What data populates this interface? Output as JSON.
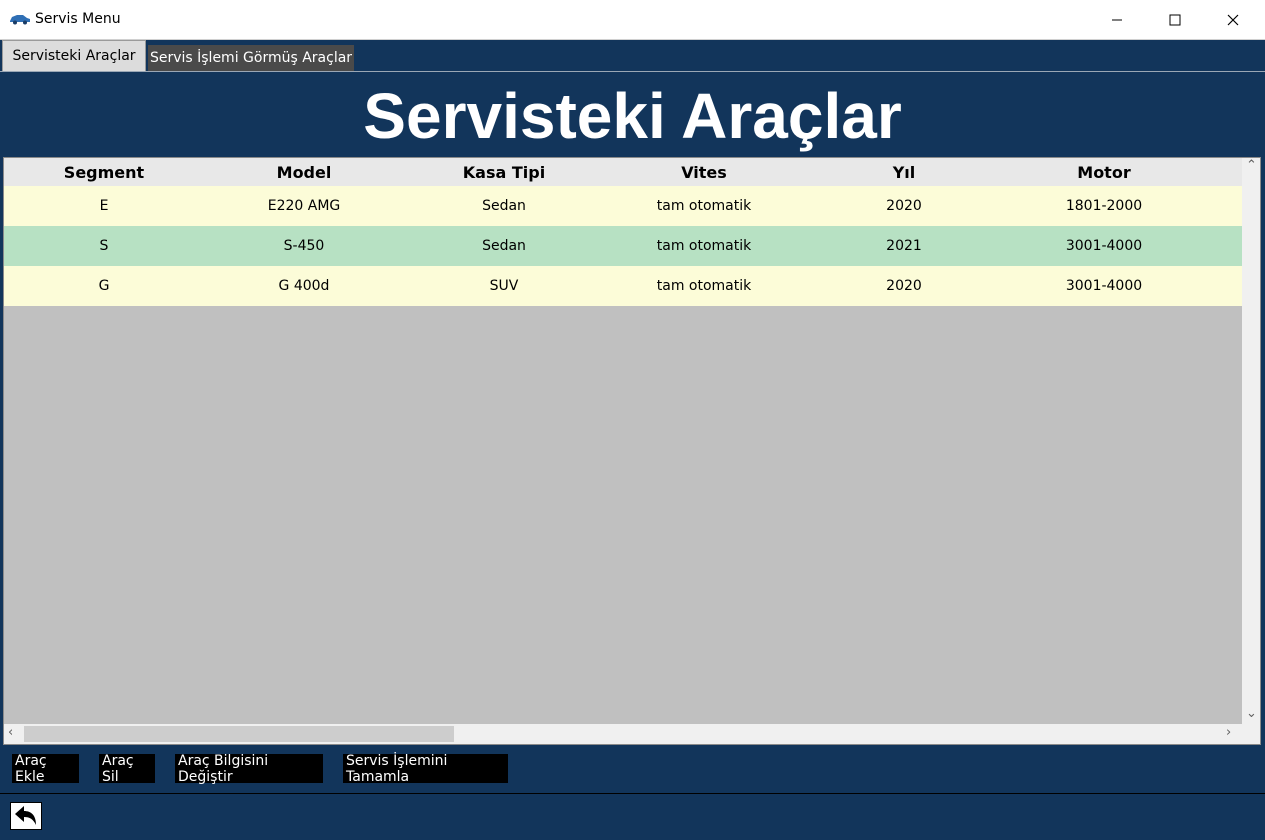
{
  "window": {
    "title": "Servis Menu",
    "icon": "car-icon",
    "controls": [
      "minimize-icon",
      "maximize-icon",
      "close-icon"
    ]
  },
  "tabs": [
    {
      "label": "Servisteki Araçlar",
      "active": true
    },
    {
      "label": "Servis İşlemi Görmüş Araçlar",
      "active": false
    }
  ],
  "heading": "Servisteki Araçlar",
  "table": {
    "columns": [
      "Segment",
      "Model",
      "Kasa Tipi",
      "Vites",
      "Yıl",
      "Motor"
    ],
    "rows": [
      [
        "E",
        "E220 AMG",
        "Sedan",
        "tam otomatik",
        "2020",
        "1801-2000"
      ],
      [
        "S",
        "S-450",
        "Sedan",
        "tam otomatik",
        "2021",
        "3001-4000"
      ],
      [
        "G",
        "G 400d",
        "SUV",
        "tam otomatik",
        "2020",
        "3001-4000"
      ]
    ],
    "row_colors": [
      "#fcfcd8",
      "#b7e1c3",
      "#fcfcd8"
    ]
  },
  "buttons": {
    "add": "Araç Ekle",
    "delete": "Araç Sil",
    "edit": "Araç Bilgisini Değiştir",
    "complete": "Servis İşlemini Tamamla"
  },
  "back_button_icon": "back-arrow-icon",
  "colors": {
    "background": "#12355b",
    "header_bg": "#e8e8e8",
    "grid_empty": "#c0c0c0",
    "button_bg": "#000000"
  }
}
